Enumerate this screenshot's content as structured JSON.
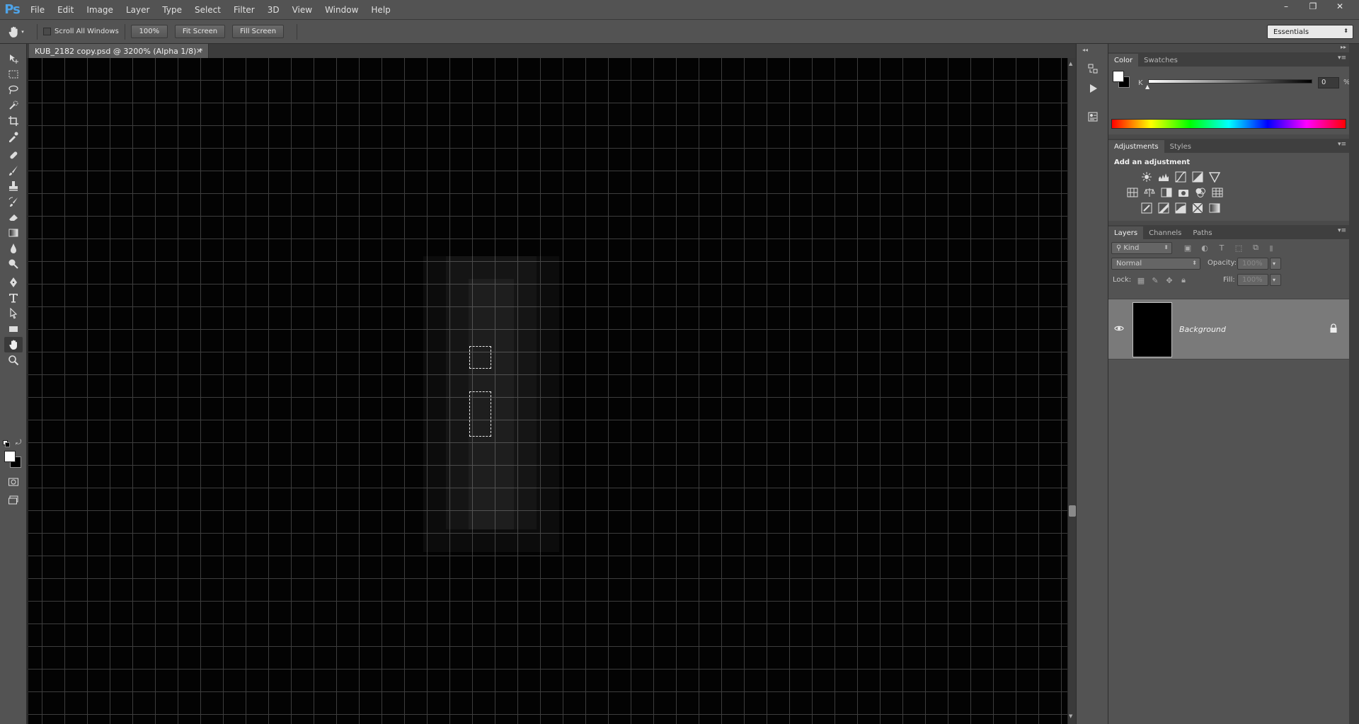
{
  "app": {
    "logo": "Ps"
  },
  "menu": [
    "File",
    "Edit",
    "Image",
    "Layer",
    "Type",
    "Select",
    "Filter",
    "3D",
    "View",
    "Window",
    "Help"
  ],
  "window_controls": {
    "minimize": "–",
    "restore": "❐",
    "close": "✕"
  },
  "options": {
    "scroll_all_windows": "Scroll All Windows",
    "zoom_100": "100%",
    "fit_screen": "Fit Screen",
    "fill_screen": "Fill Screen",
    "workspace": "Essentials"
  },
  "document": {
    "tab_title": "KUB_2182 copy.psd @ 3200% (Alpha 1/8) *",
    "close": "×"
  },
  "color_panel": {
    "tabs": [
      "Color",
      "Swatches"
    ],
    "channel_label": "K",
    "value": "0",
    "unit": "%"
  },
  "adjustments_panel": {
    "tabs": [
      "Adjustments",
      "Styles"
    ],
    "heading": "Add an adjustment"
  },
  "layers_panel": {
    "tabs": [
      "Layers",
      "Channels",
      "Paths"
    ],
    "filter_kind": "Kind",
    "blend_mode": "Normal",
    "opacity_label": "Opacity:",
    "opacity_value": "100%",
    "lock_label": "Lock:",
    "fill_label": "Fill:",
    "fill_value": "100%",
    "layers": [
      {
        "name": "Background",
        "visible": true,
        "locked": true
      }
    ]
  },
  "colors": {
    "accent": "#4ea3e8",
    "canvas": "#030303",
    "grid": "#3d3d3d",
    "ui": "#535353"
  }
}
